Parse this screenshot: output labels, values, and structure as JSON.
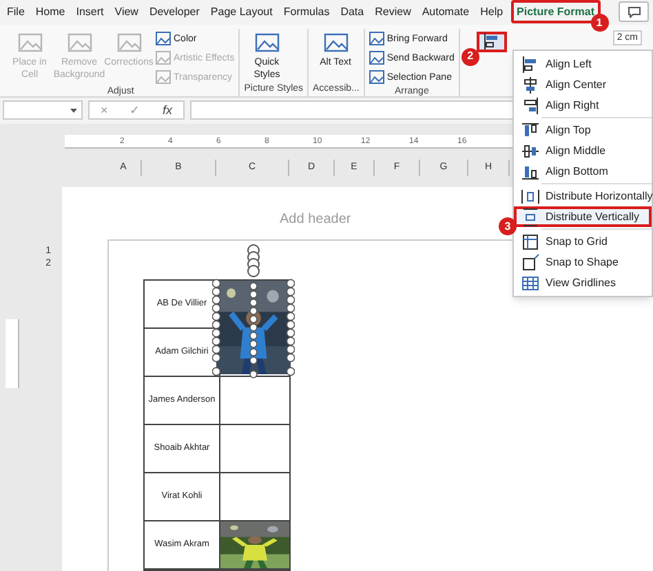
{
  "tabs": [
    {
      "label": "File",
      "selected": false
    },
    {
      "label": "Home",
      "selected": false
    },
    {
      "label": "Insert",
      "selected": false
    },
    {
      "label": "View",
      "selected": false
    },
    {
      "label": "Developer",
      "selected": false
    },
    {
      "label": "Page Layout",
      "selected": false
    },
    {
      "label": "Formulas",
      "selected": false
    },
    {
      "label": "Data",
      "selected": false
    },
    {
      "label": "Review",
      "selected": false
    },
    {
      "label": "Automate",
      "selected": false
    },
    {
      "label": "Help",
      "selected": false
    },
    {
      "label": "Picture Format",
      "selected": true,
      "badge": "1"
    }
  ],
  "ribbon": {
    "groups": [
      {
        "label": "Adjust",
        "items": [
          {
            "kind": "large",
            "label": "Place in Cell",
            "disabled": true
          },
          {
            "kind": "large",
            "label": "Remove Background",
            "disabled": true
          },
          {
            "kind": "large",
            "label": "Corrections",
            "disabled": true
          },
          {
            "kind": "small",
            "label": "Color",
            "disabled": false
          },
          {
            "kind": "small",
            "label": "Artistic Effects",
            "disabled": true
          },
          {
            "kind": "small",
            "label": "Transparency",
            "disabled": true
          }
        ]
      },
      {
        "label": "Picture Styles",
        "items": [
          {
            "kind": "large",
            "label": "Quick Styles",
            "disabled": false
          }
        ]
      },
      {
        "label": "Accessib...",
        "items": [
          {
            "kind": "large",
            "label": "Alt Text",
            "disabled": false
          }
        ]
      },
      {
        "label": "Arrange",
        "items": [
          {
            "kind": "small",
            "label": "Bring Forward",
            "disabled": false
          },
          {
            "kind": "small",
            "label": "Send Backward",
            "disabled": false
          },
          {
            "kind": "small",
            "label": "Selection Pane",
            "disabled": false
          }
        ]
      }
    ]
  },
  "align_button": {
    "badge": "2"
  },
  "size_field": {
    "value": "2 cm"
  },
  "formula_bar": {
    "cancel": "×",
    "enter": "✓",
    "function": "fx"
  },
  "ruler": [
    "2",
    "4",
    "6",
    "8",
    "10",
    "12",
    "14",
    "16"
  ],
  "columns": [
    "A",
    "B",
    "C",
    "D",
    "E",
    "F",
    "G",
    "H"
  ],
  "row_numbers": [
    "1",
    "2"
  ],
  "page": {
    "header_placeholder": "Add header"
  },
  "table": {
    "rows": [
      {
        "name": "AB De Villier"
      },
      {
        "name": "Adam Gilchiri"
      },
      {
        "name": "James Anderson",
        "picture": false
      },
      {
        "name": "Shoaib Akhtar",
        "picture": false
      },
      {
        "name": "Virat Kohli",
        "picture": false
      },
      {
        "name": "Wasim Akram",
        "picture": true
      }
    ]
  },
  "floating_picture": {
    "selected": true
  },
  "align_menu": {
    "items": [
      {
        "kind": "align-left",
        "label": "Align Left",
        "selected": false,
        "separator_after": false
      },
      {
        "kind": "align-center",
        "label": "Align Center",
        "selected": false,
        "separator_after": false
      },
      {
        "kind": "align-right",
        "label": "Align Right",
        "selected": false,
        "separator_after": true
      },
      {
        "kind": "align-top",
        "label": "Align Top",
        "selected": false,
        "separator_after": false
      },
      {
        "kind": "align-middle",
        "label": "Align Middle",
        "selected": false,
        "separator_after": false
      },
      {
        "kind": "align-bottom",
        "label": "Align Bottom",
        "selected": false,
        "separator_after": true
      },
      {
        "kind": "distribute-h",
        "label": "Distribute Horizontally",
        "selected": false,
        "separator_after": false
      },
      {
        "kind": "distribute-v",
        "label": "Distribute Vertically",
        "selected": true,
        "badge": "3",
        "separator_after": true
      },
      {
        "kind": "snap-grid",
        "label": "Snap to Grid",
        "selected": false,
        "separator_after": false
      },
      {
        "kind": "snap-shape",
        "label": "Snap to Shape",
        "selected": false,
        "separator_after": false
      },
      {
        "kind": "gridlines",
        "label": "View Gridlines",
        "selected": false,
        "separator_after": false
      }
    ]
  }
}
